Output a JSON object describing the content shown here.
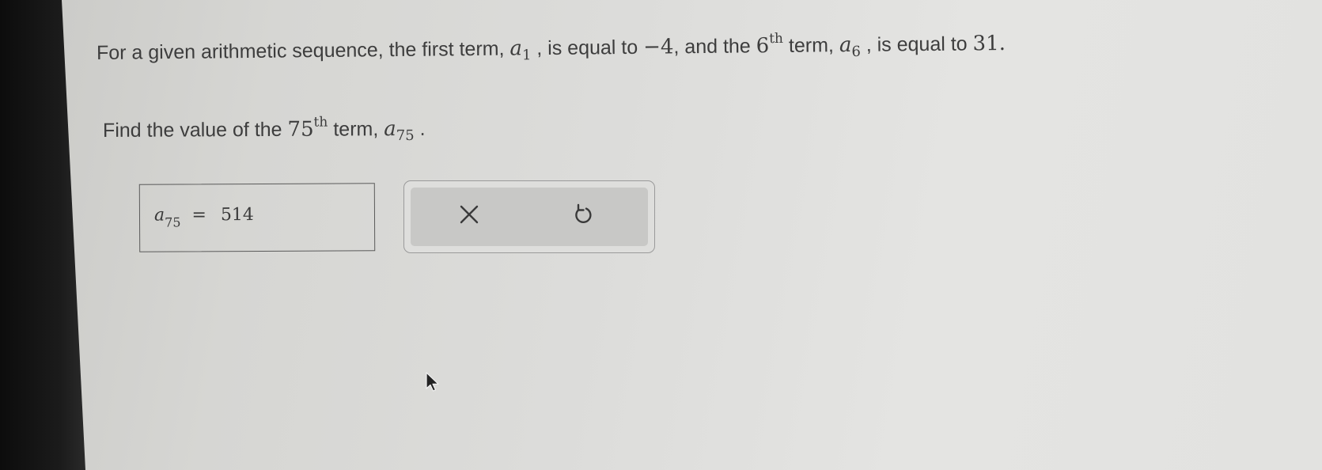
{
  "question": {
    "line1": {
      "part1": "For a given arithmetic sequence, the first term, ",
      "var1": "a",
      "var1_sub": "1",
      "part2": " , is equal to ",
      "value1": "−4",
      "part3": ", and the ",
      "term_num": "6",
      "term_sup": "th",
      "part4": " term, ",
      "var2": "a",
      "var2_sub": "6",
      "part5": " , is equal to ",
      "value2": "31",
      "part6": "."
    },
    "line2": {
      "part1": "Find the value of the ",
      "term_num": "75",
      "term_sup": "th",
      "part2": " term, ",
      "var": "a",
      "var_sub": "75",
      "part3": " ."
    }
  },
  "answer": {
    "var": "a",
    "var_sub": "75",
    "equals": "=",
    "value": "514"
  },
  "buttons": {
    "clear_icon": "x-icon",
    "undo_icon": "undo-icon"
  },
  "colors": {
    "text": "#3d3d3d",
    "button_panel": "#c8c8c6",
    "icon": "#3a3a3a"
  }
}
